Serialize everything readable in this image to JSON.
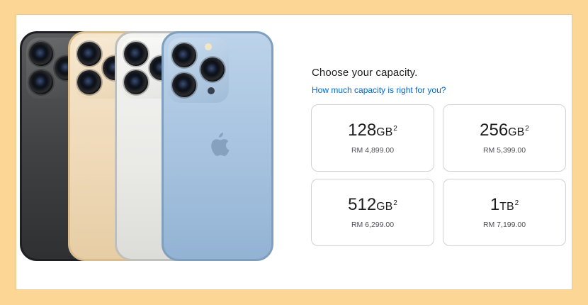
{
  "heading": "Choose your capacity.",
  "help_link": "How much capacity is right for you?",
  "options": [
    {
      "amount": "128",
      "unit": "GB",
      "footnote": "2",
      "price": "RM 4,899.00"
    },
    {
      "amount": "256",
      "unit": "GB",
      "footnote": "2",
      "price": "RM 5,399.00"
    },
    {
      "amount": "512",
      "unit": "GB",
      "footnote": "2",
      "price": "RM 6,299.00"
    },
    {
      "amount": "1",
      "unit": "TB",
      "footnote": "2",
      "price": "RM 7,199.00"
    }
  ],
  "colors": {
    "background": "#fbd694",
    "link": "#0066cc",
    "card_border": "#d2d2d7",
    "phones": [
      "#3f4042",
      "#eed8b6",
      "#e9e9e6",
      "#a6c2df"
    ]
  },
  "icons": [
    "apple-logo-icon",
    "camera-lens-icon"
  ]
}
